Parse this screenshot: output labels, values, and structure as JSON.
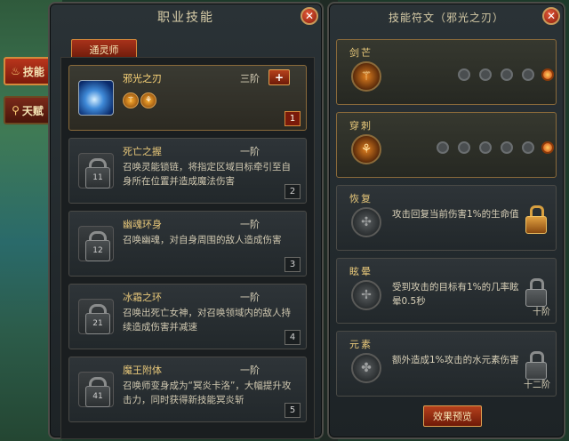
{
  "side_tabs": {
    "skills": "技能",
    "talents": "天赋"
  },
  "skills_panel": {
    "title": "职业技能",
    "class_tab": "通灵师",
    "skills": [
      {
        "name": "邪光之刃",
        "tier": "三阶",
        "desc": "",
        "num": "1",
        "plus": "+"
      },
      {
        "name": "死亡之握",
        "tier": "一阶",
        "desc": "召唤灵能锁链，将指定区域目标牵引至自身所在位置并造成魔法伤害",
        "num": "2",
        "lock": "11"
      },
      {
        "name": "幽魂环身",
        "tier": "一阶",
        "desc": "召唤幽魂，对自身周围的敌人造成伤害",
        "num": "3",
        "lock": "12"
      },
      {
        "name": "冰霜之环",
        "tier": "一阶",
        "desc": "召唤出死亡女神，对召唤领域内的敌人持续造成伤害并减速",
        "num": "4",
        "lock": "21"
      },
      {
        "name": "魔王附体",
        "tier": "一阶",
        "desc": "召唤师变身成为“冥炎卡洛”，大幅提升攻击力，同时获得新技能冥炎斩",
        "num": "5",
        "lock": "41"
      }
    ]
  },
  "runes_panel": {
    "title": "技能符文（邪光之刃）",
    "runes": [
      {
        "name": "剑芒",
        "desc": "",
        "req": ""
      },
      {
        "name": "穿刺",
        "desc": "",
        "req": ""
      },
      {
        "name": "恢复",
        "desc": "攻击回复当前伤害1%的生命值",
        "req": ""
      },
      {
        "name": "眩晕",
        "desc": "受到攻击的目标有1%的几率眩晕0.5秒",
        "req": "十阶"
      },
      {
        "name": "元素",
        "desc": "额外造成1%攻击的水元素伤害",
        "req": "十二阶"
      }
    ],
    "preview_button": "效果预览"
  },
  "close_label": "✕",
  "colors": {
    "accent_red": "#b5401c",
    "gold_text": "#e8c87a",
    "panel_bg": "#22282b"
  }
}
